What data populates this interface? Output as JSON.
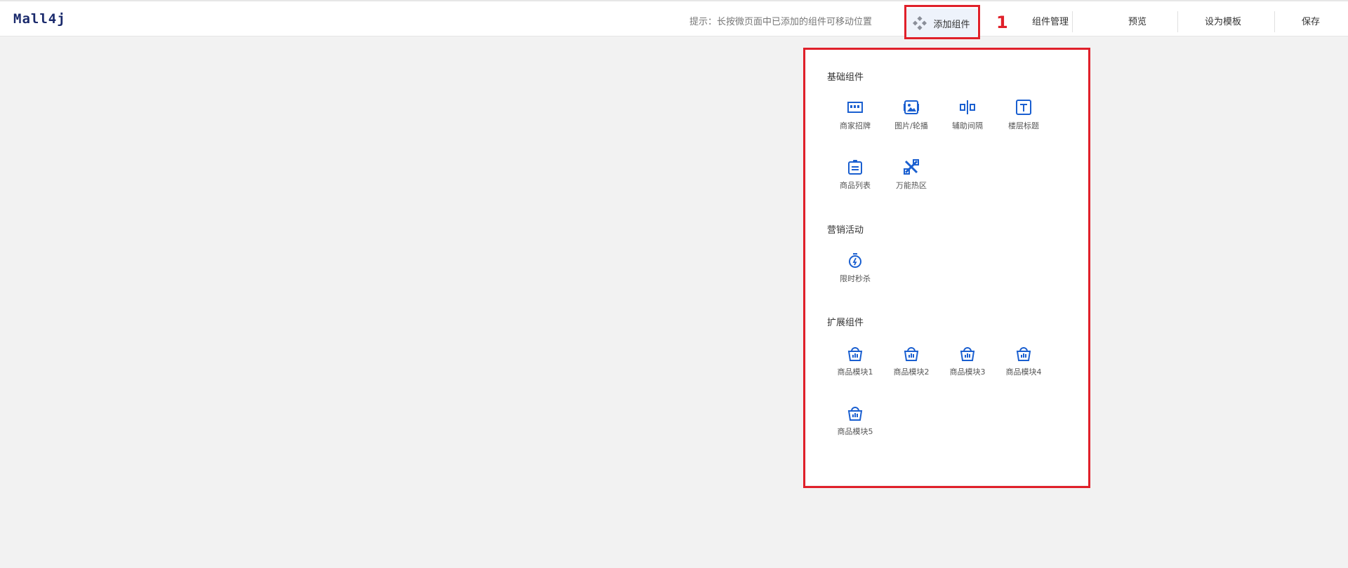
{
  "header": {
    "logo": "Mall4j",
    "hint": "提示：长按微页面中已添加的组件可移动位置",
    "add_component": "添加组件",
    "annotation_number": "1",
    "nav": [
      "组件管理",
      "预览",
      "设为模板",
      "保存"
    ]
  },
  "panel": {
    "sections": [
      {
        "title": "基础组件",
        "items": [
          {
            "label": "商家招牌",
            "icon": "shop-sign-icon"
          },
          {
            "label": "图片/轮播",
            "icon": "image-carousel-icon"
          },
          {
            "label": "辅助间隔",
            "icon": "spacer-icon"
          },
          {
            "label": "楼层标题",
            "icon": "title-text-icon"
          },
          {
            "label": "商品列表",
            "icon": "product-list-icon"
          },
          {
            "label": "万能热区",
            "icon": "hotzone-tools-icon"
          }
        ]
      },
      {
        "title": "营销活动",
        "items": [
          {
            "label": "限时秒杀",
            "icon": "stopwatch-icon"
          }
        ]
      },
      {
        "title": "扩展组件",
        "items": [
          {
            "label": "商品模块1",
            "icon": "basket-icon"
          },
          {
            "label": "商品模块2",
            "icon": "basket-icon"
          },
          {
            "label": "商品模块3",
            "icon": "basket-icon"
          },
          {
            "label": "商品模块4",
            "icon": "basket-icon"
          },
          {
            "label": "商品模块5",
            "icon": "basket-icon"
          }
        ]
      }
    ]
  },
  "colors": {
    "accent": "#1a5fd0",
    "highlight": "#e0202a",
    "background": "#f2f2f2"
  }
}
